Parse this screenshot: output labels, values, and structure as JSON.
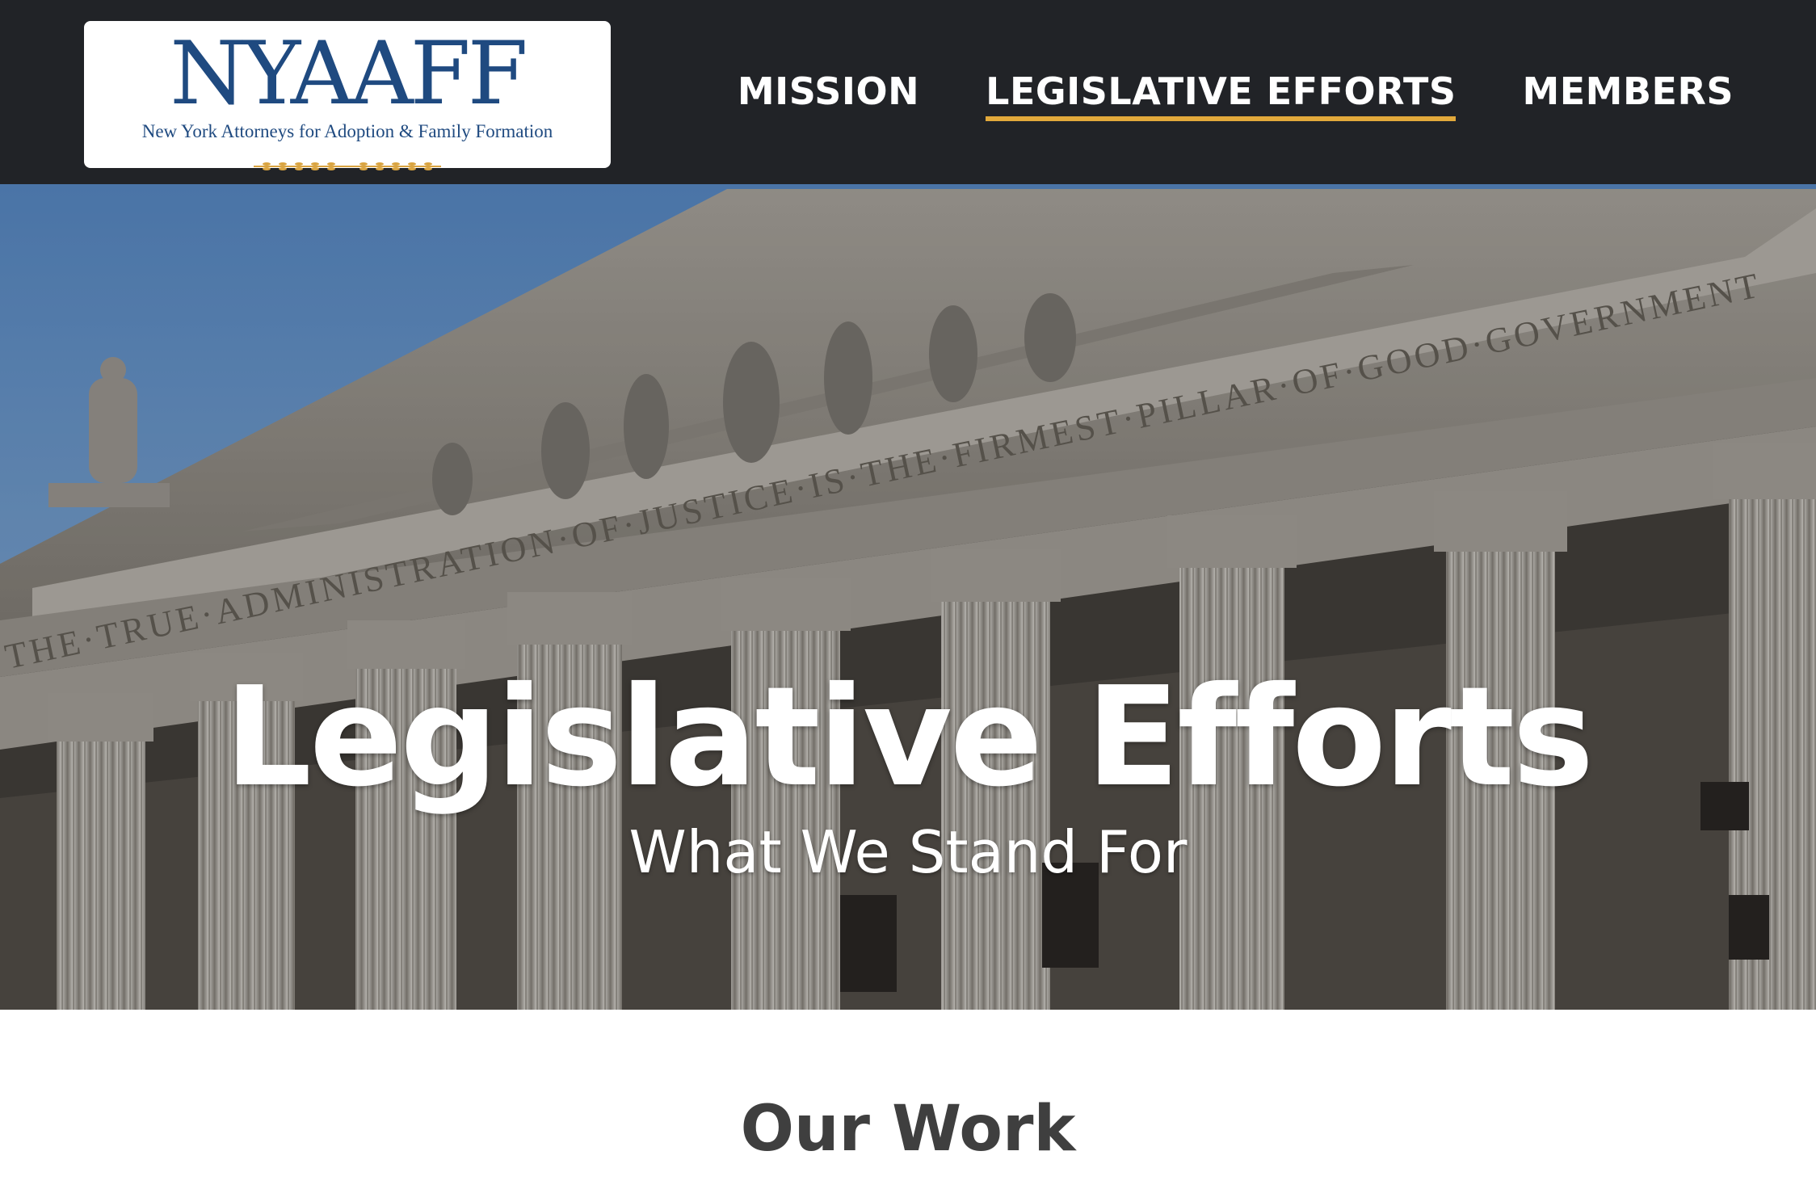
{
  "header": {
    "logo": {
      "wordmark": "NYAAFF",
      "tagline": "New York Attorneys for Adoption & Family Formation"
    },
    "nav": [
      {
        "label": "MISSION",
        "active": false
      },
      {
        "label": "LEGISLATIVE EFFORTS",
        "active": true
      },
      {
        "label": "MEMBERS",
        "active": false
      }
    ],
    "accent_color": "#e2a93b",
    "background_color": "#212327"
  },
  "hero": {
    "title": "Legislative Efforts",
    "subtitle": "What We Stand For",
    "image_subject": "courthouse-facade",
    "inscription": "THE·TRUE·ADMINISTRATION·OF·JUSTICE·IS·THE·FIRMEST·PILLAR·OF·GOOD·GOVERNMENT"
  },
  "content": {
    "section_title": "Our Work"
  }
}
